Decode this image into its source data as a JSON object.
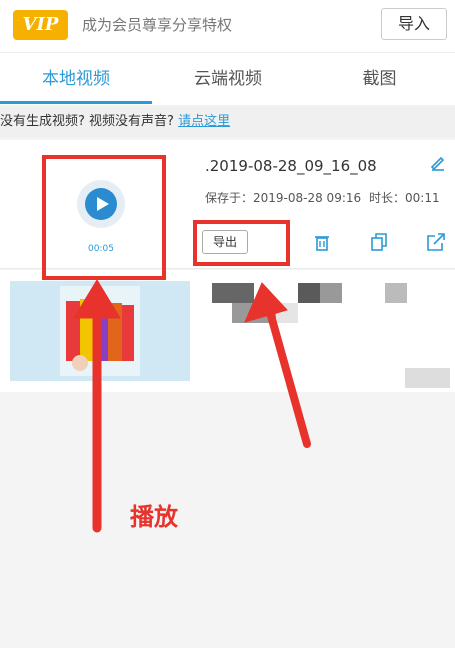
{
  "header": {
    "vip_badge": "VIP",
    "vip_promo": "成为会员尊享分享特权",
    "import_label": "导入"
  },
  "tabs": [
    {
      "label": "本地视频",
      "active": true
    },
    {
      "label": "云端视频",
      "active": false
    },
    {
      "label": "截图",
      "active": false
    }
  ],
  "hint": {
    "text": "没有生成视频? 视频没有声音? ",
    "link": "请点这里"
  },
  "item": {
    "thumb_time": "00:05",
    "name": ".2019-08-28_09_16_08",
    "saved": "保存于：2019-08-28 09:16",
    "duration": "时长：00:11",
    "export_label": "导出"
  },
  "annotation": {
    "label": "播放",
    "color": "#e8322c"
  },
  "colors": {
    "accent": "#2a9ad8",
    "vip": "#f5b000"
  },
  "icons": [
    "edit-icon",
    "trash-icon",
    "copy-icon",
    "share-icon",
    "play-icon"
  ]
}
